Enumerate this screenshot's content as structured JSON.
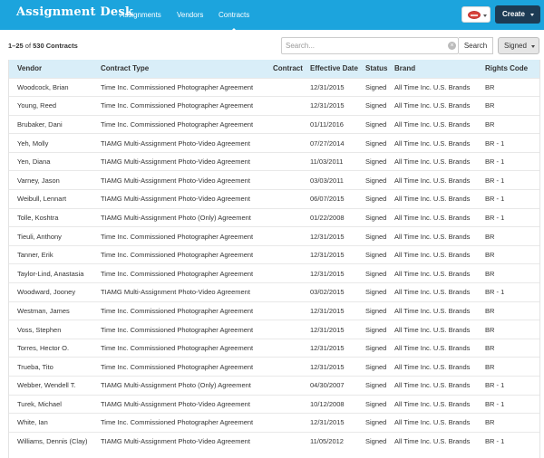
{
  "navbar": {
    "brand": "Assignment Desk",
    "links": [
      "Assignments",
      "Vendors",
      "Contracts"
    ],
    "active_link": "Contracts",
    "create_label": "Create",
    "color": "#1ca4dd"
  },
  "toolbar": {
    "count_range": "1–25",
    "count_of": "of",
    "count_total": "530 Contracts",
    "search_placeholder": "Search...",
    "search_value": "",
    "search_button": "Search",
    "filter_value": "Signed"
  },
  "table": {
    "headers": [
      "Vendor",
      "Contract Type",
      "Contract",
      "Effective Date",
      "Status",
      "Brand",
      "Rights Code"
    ],
    "rows": [
      {
        "vendor": "Woodcock, Brian",
        "type": "Time Inc. Commissioned Photographer Agreement",
        "contract": "",
        "date": "12/31/2015",
        "status": "Signed",
        "brand": "All Time Inc. U.S. Brands",
        "rights": "BR"
      },
      {
        "vendor": "Young, Reed",
        "type": "Time Inc. Commissioned Photographer Agreement",
        "contract": "",
        "date": "12/31/2015",
        "status": "Signed",
        "brand": "All Time Inc. U.S. Brands",
        "rights": "BR"
      },
      {
        "vendor": "Brubaker, Dani",
        "type": "Time Inc. Commissioned Photographer Agreement",
        "contract": "",
        "date": "01/11/2016",
        "status": "Signed",
        "brand": "All Time Inc. U.S. Brands",
        "rights": "BR"
      },
      {
        "vendor": "Yeh, Molly",
        "type": "TIAMG Multi-Assignment Photo-Video Agreement",
        "contract": "",
        "date": "07/27/2014",
        "status": "Signed",
        "brand": "All Time Inc. U.S. Brands",
        "rights": "BR - 1"
      },
      {
        "vendor": "Yen, Diana",
        "type": "TIAMG Multi-Assignment Photo-Video Agreement",
        "contract": "",
        "date": "11/03/2011",
        "status": "Signed",
        "brand": "All Time Inc. U.S. Brands",
        "rights": "BR - 1"
      },
      {
        "vendor": "Varney, Jason",
        "type": "TIAMG Multi-Assignment Photo-Video Agreement",
        "contract": "",
        "date": "03/03/2011",
        "status": "Signed",
        "brand": "All Time Inc. U.S. Brands",
        "rights": "BR - 1"
      },
      {
        "vendor": "Weibull, Lennart",
        "type": "TIAMG Multi-Assignment Photo-Video Agreement",
        "contract": "",
        "date": "06/07/2015",
        "status": "Signed",
        "brand": "All Time Inc. U.S. Brands",
        "rights": "BR - 1"
      },
      {
        "vendor": "Tolle, Koshtra",
        "type": "TIAMG Multi-Assignment Photo (Only) Agreement",
        "contract": "",
        "date": "01/22/2008",
        "status": "Signed",
        "brand": "All Time Inc. U.S. Brands",
        "rights": "BR - 1"
      },
      {
        "vendor": "Tieuli, Anthony",
        "type": "Time Inc. Commissioned Photographer Agreement",
        "contract": "",
        "date": "12/31/2015",
        "status": "Signed",
        "brand": "All Time Inc. U.S. Brands",
        "rights": "BR"
      },
      {
        "vendor": "Tanner, Erik",
        "type": "Time Inc. Commissioned Photographer Agreement",
        "contract": "",
        "date": "12/31/2015",
        "status": "Signed",
        "brand": "All Time Inc. U.S. Brands",
        "rights": "BR"
      },
      {
        "vendor": "Taylor-Lind, Anastasia",
        "type": "Time Inc. Commissioned Photographer Agreement",
        "contract": "",
        "date": "12/31/2015",
        "status": "Signed",
        "brand": "All Time Inc. U.S. Brands",
        "rights": "BR"
      },
      {
        "vendor": "Woodward, Jooney",
        "type": "TIAMG Multi-Assignment Photo-Video Agreement",
        "contract": "",
        "date": "03/02/2015",
        "status": "Signed",
        "brand": "All Time Inc. U.S. Brands",
        "rights": "BR - 1"
      },
      {
        "vendor": "Westman, James",
        "type": "Time Inc. Commissioned Photographer Agreement",
        "contract": "",
        "date": "12/31/2015",
        "status": "Signed",
        "brand": "All Time Inc. U.S. Brands",
        "rights": "BR"
      },
      {
        "vendor": "Voss, Stephen",
        "type": "Time Inc. Commissioned Photographer Agreement",
        "contract": "",
        "date": "12/31/2015",
        "status": "Signed",
        "brand": "All Time Inc. U.S. Brands",
        "rights": "BR"
      },
      {
        "vendor": "Torres, Hector O.",
        "type": "Time Inc. Commissioned Photographer Agreement",
        "contract": "",
        "date": "12/31/2015",
        "status": "Signed",
        "brand": "All Time Inc. U.S. Brands",
        "rights": "BR"
      },
      {
        "vendor": "Trueba, Tito",
        "type": "Time Inc. Commissioned Photographer Agreement",
        "contract": "",
        "date": "12/31/2015",
        "status": "Signed",
        "brand": "All Time Inc. U.S. Brands",
        "rights": "BR"
      },
      {
        "vendor": "Webber, Wendell T.",
        "type": "TIAMG Multi-Assignment Photo (Only) Agreement",
        "contract": "",
        "date": "04/30/2007",
        "status": "Signed",
        "brand": "All Time Inc. U.S. Brands",
        "rights": "BR - 1"
      },
      {
        "vendor": "Turek, Michael",
        "type": "TIAMG Multi-Assignment Photo-Video Agreement",
        "contract": "",
        "date": "10/12/2008",
        "status": "Signed",
        "brand": "All Time Inc. U.S. Brands",
        "rights": "BR - 1"
      },
      {
        "vendor": "White, Ian",
        "type": "Time Inc. Commissioned Photographer Agreement",
        "contract": "",
        "date": "12/31/2015",
        "status": "Signed",
        "brand": "All Time Inc. U.S. Brands",
        "rights": "BR"
      },
      {
        "vendor": "Williams, Dennis (Clay)",
        "type": "TIAMG Multi-Assignment Photo-Video Agreement",
        "contract": "",
        "date": "11/05/2012",
        "status": "Signed",
        "brand": "All Time Inc. U.S. Brands",
        "rights": "BR - 1"
      }
    ]
  }
}
